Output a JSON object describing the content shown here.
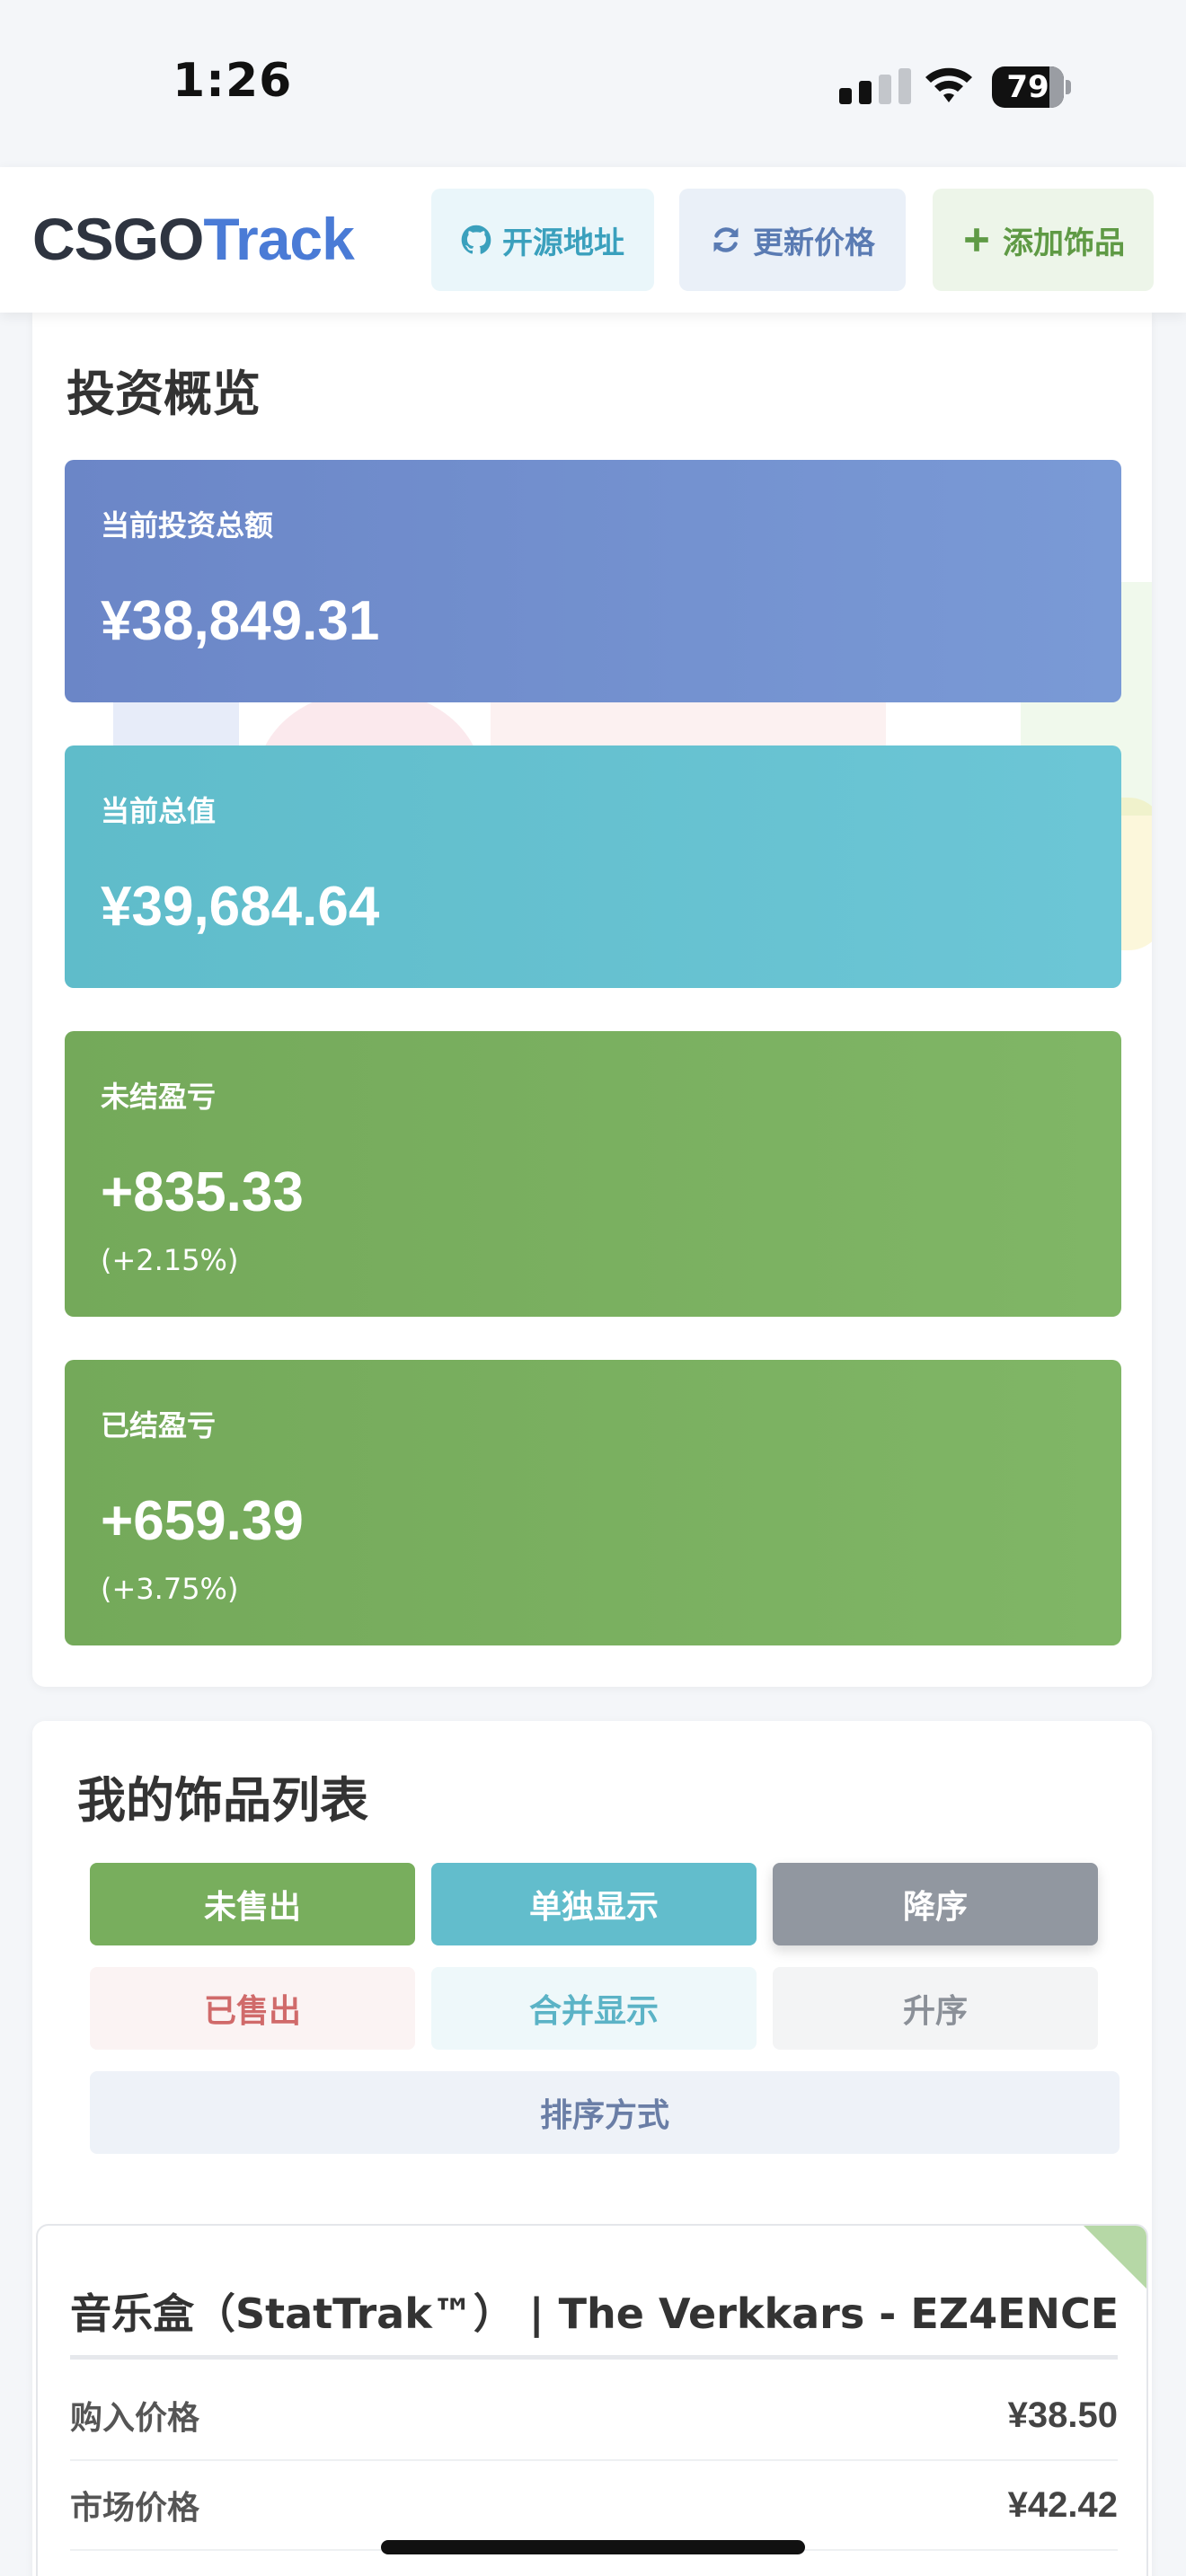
{
  "status_bar": {
    "time": "1:26",
    "battery": "79"
  },
  "header": {
    "brand_part1": "CSGO",
    "brand_part2": "Track",
    "buttons": {
      "source": "开源地址",
      "update": "更新价格",
      "add": "添加饰品"
    }
  },
  "overview": {
    "title": "投资概览",
    "stats": {
      "invest": {
        "label": "当前投资总额",
        "value": "¥38,849.31"
      },
      "total": {
        "label": "当前总值",
        "value": "¥39,684.64"
      },
      "unrealized": {
        "label": "未结盈亏",
        "value": "+835.33",
        "percent": "(+2.15%)"
      },
      "realized": {
        "label": "已结盈亏",
        "value": "+659.39",
        "percent": "(+3.75%)"
      }
    }
  },
  "list": {
    "title": "我的饰品列表",
    "filters": {
      "unsold": "未售出",
      "sold": "已售出",
      "single": "单独显示",
      "merged": "合并显示",
      "desc": "降序",
      "asc": "升序",
      "sort": "排序方式"
    },
    "items": [
      {
        "name": "音乐盒（StatTrak™） | The Verkkars - EZ4ENCE",
        "rows": [
          {
            "label": "购入价格",
            "value": "¥38.50"
          },
          {
            "label": "市场价格",
            "value": "¥42.42"
          }
        ]
      }
    ]
  },
  "colors": {
    "accent_blue": "#4a7bd6",
    "invest_card": "#6b86c7",
    "total_card": "#5fbcca",
    "profit_card": "#74a95a",
    "sold_red": "#d06a6a"
  },
  "icons": {
    "source": "github-icon",
    "update": "refresh-icon",
    "add": "plus-icon"
  }
}
